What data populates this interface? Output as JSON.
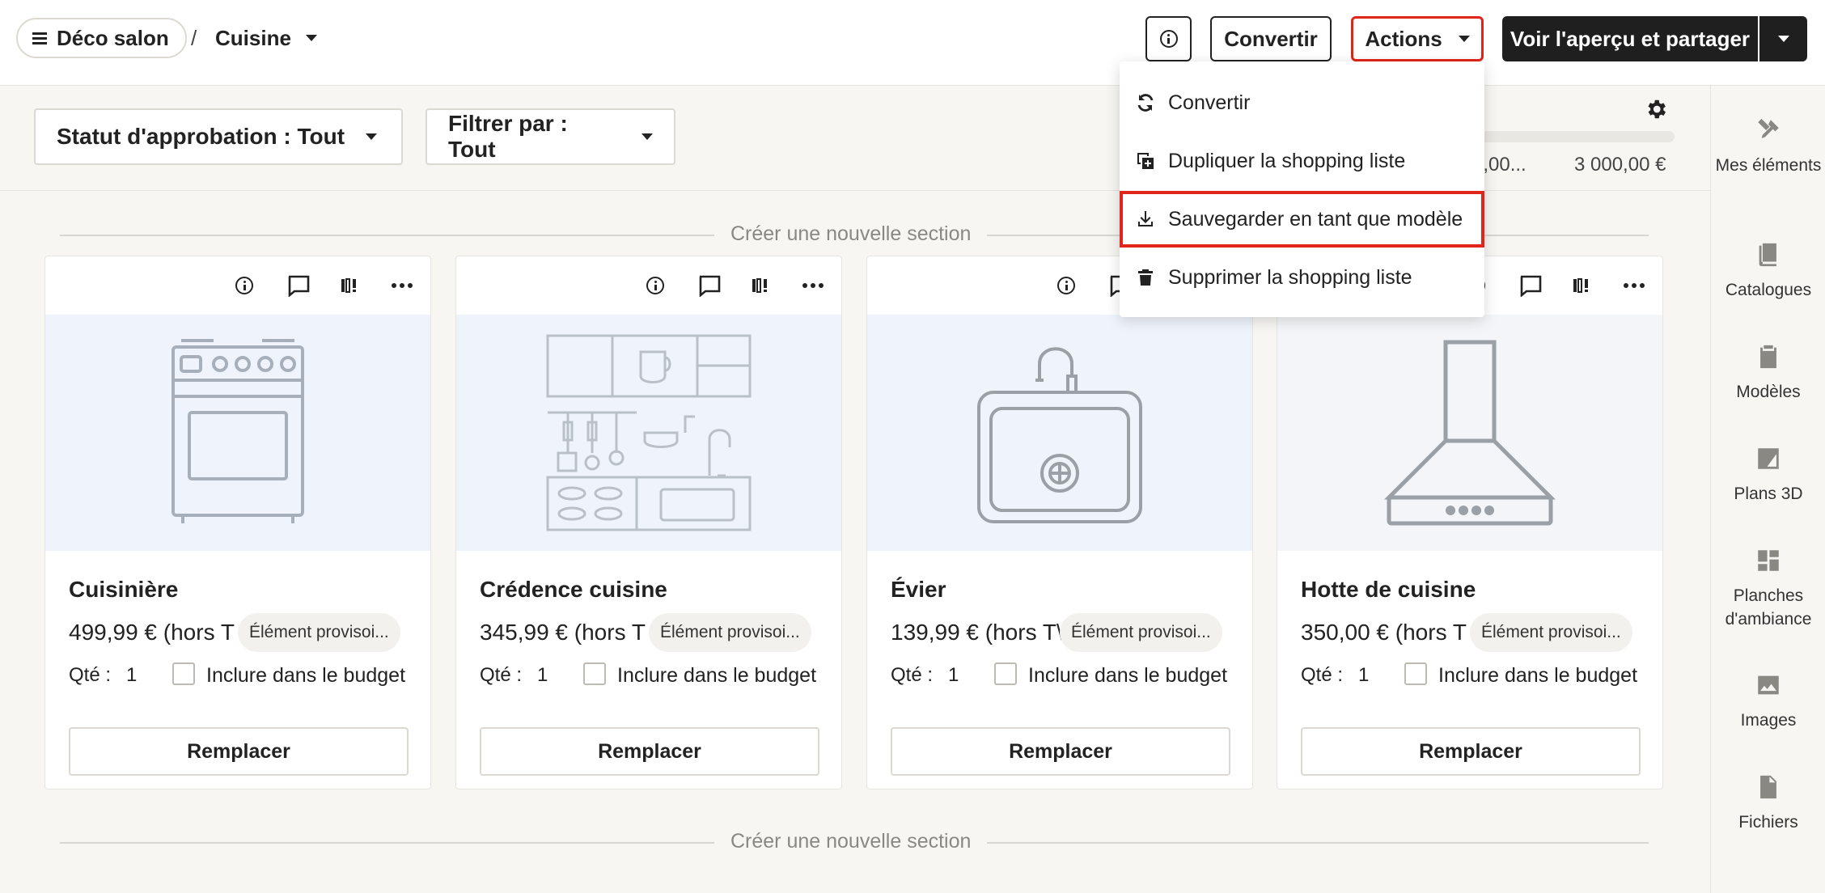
{
  "header": {
    "project_name": "Déco salon",
    "breadcrumb_separator": "/",
    "room_name": "Cuisine",
    "convert_label": "Convertir",
    "actions_label": "Actions",
    "share_label": "Voir l'aperçu et partager"
  },
  "actions_menu": {
    "items": [
      {
        "label": "Convertir",
        "icon": "refresh-icon"
      },
      {
        "label": "Dupliquer la shopping liste",
        "icon": "duplicate-icon"
      },
      {
        "label": "Sauvegarder en tant que modèle",
        "icon": "download-icon",
        "highlighted": true
      },
      {
        "label": "Supprimer la shopping liste",
        "icon": "trash-icon"
      }
    ]
  },
  "filters": {
    "approval_status": "Statut d'approbation : Tout",
    "filter_by": "Filtrer par : Tout"
  },
  "budget": {
    "left_value": "0,00...",
    "right_value": "3 000,00 €"
  },
  "sections": {
    "create_section_label": "Créer une nouvelle section"
  },
  "cards": [
    {
      "name": "Cuisinière",
      "price": "499,99 € (hors T",
      "badge": "Élément provisoi...",
      "qty_label": "Qté :",
      "qty": "1",
      "checkbox_label": "Inclure dans le budget",
      "replace_label": "Remplacer",
      "illustration": "stove-icon"
    },
    {
      "name": "Crédence cuisine",
      "price": "345,99 € (hors T",
      "badge": "Élément provisoi...",
      "qty_label": "Qté :",
      "qty": "1",
      "checkbox_label": "Inclure dans le budget",
      "replace_label": "Remplacer",
      "illustration": "kitchen-backsplash-icon"
    },
    {
      "name": "Évier",
      "price": "139,99 € (hors T\\",
      "badge": "Élément provisoi...",
      "qty_label": "Qté :",
      "qty": "1",
      "checkbox_label": "Inclure dans le budget",
      "replace_label": "Remplacer",
      "illustration": "sink-icon"
    },
    {
      "name": "Hotte de cuisine",
      "price": "350,00 € (hors T",
      "badge": "Élément provisoi...",
      "qty_label": "Qté :",
      "qty": "1",
      "checkbox_label": "Inclure dans le budget",
      "replace_label": "Remplacer",
      "illustration": "range-hood-icon"
    }
  ],
  "sidebar": {
    "items": [
      {
        "label": "Mes éléments",
        "icon": "tools-icon"
      },
      {
        "label": "Catalogues",
        "icon": "book-icon"
      },
      {
        "label": "Modèles",
        "icon": "clipboard-icon"
      },
      {
        "label": "Plans 3D",
        "icon": "floorplan-icon"
      },
      {
        "label": "Planches d'ambiance",
        "icon": "moodboard-icon"
      },
      {
        "label": "Images",
        "icon": "image-icon"
      },
      {
        "label": "Fichiers",
        "icon": "file-icon"
      }
    ]
  },
  "colors": {
    "highlight": "#e0251b",
    "dark_button": "#1f1f1f",
    "background": "#f7f6f3",
    "card_image_bg": "#eff3fb"
  }
}
